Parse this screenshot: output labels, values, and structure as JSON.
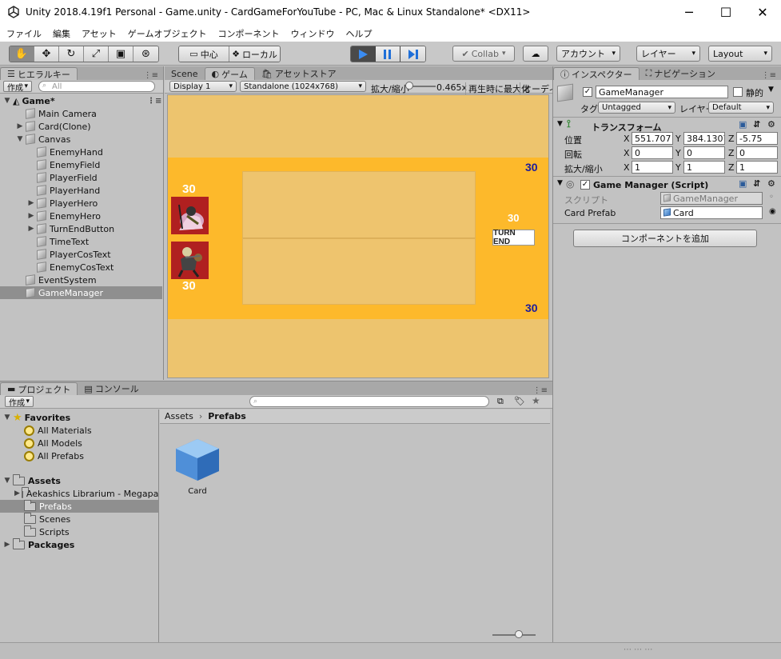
{
  "window": {
    "title": "Unity 2018.4.19f1 Personal - Game.unity - CardGameForYouTube - PC, Mac & Linux Standalone* <DX11>",
    "minimize": "─",
    "maximize": "☐",
    "close": "✕"
  },
  "menu": [
    "ファイル",
    "編集",
    "アセット",
    "ゲームオブジェクト",
    "コンポーネント",
    "ウィンドウ",
    "ヘルプ"
  ],
  "toolbar": {
    "pivot_label": "中心",
    "space_label": "ローカル",
    "collab_label": "Collab",
    "account_label": "アカウント",
    "layers_label": "レイヤー",
    "layout_label": "Layout"
  },
  "hierarchy": {
    "tab": "ヒエラルキー",
    "create": "作成",
    "search_placeholder": "All",
    "scene": "Game*",
    "items": [
      "Main Camera",
      "Card(Clone)",
      "Canvas",
      "EnemyHand",
      "EnemyField",
      "PlayerField",
      "PlayerHand",
      "PlayerHero",
      "EnemyHero",
      "TurnEndButton",
      "TimeText",
      "PlayerCosText",
      "EnemyCosText",
      "EventSystem",
      "GameManager"
    ]
  },
  "game_view": {
    "tabs": [
      "Scene",
      "ゲーム",
      "アセットストア"
    ],
    "display": "Display 1",
    "resolution": "Standalone (1024x768)",
    "scale_label": "拡大/縮小",
    "scale_value": "0.465x",
    "maximize_on_play": "再生時に最大化",
    "audio": "オーディオ",
    "enemy_hp": "30",
    "player_hp": "30",
    "time": "30",
    "turn_end": "TURN END",
    "enemy_cost": "30",
    "player_cost": "30",
    "colors": {
      "background": "#edc46e",
      "band": "#fdb92b",
      "field": "#eec46e",
      "cost": "#1c1c9c"
    }
  },
  "inspector": {
    "tabs": [
      "インスペクター",
      "ナビゲーション"
    ],
    "object_name": "GameManager",
    "static_label": "静的",
    "tag_label": "タグ",
    "tag_value": "Untagged",
    "layer_label": "レイヤー",
    "layer_value": "Default",
    "transform": {
      "title": "トランスフォーム",
      "position_label": "位置",
      "rotation_label": "回転",
      "scale_label": "拡大/縮小",
      "position": [
        "551.707",
        "384.1307",
        "-5.75"
      ],
      "rotation": [
        "0",
        "0",
        "0"
      ],
      "scale": [
        "1",
        "1",
        "1"
      ]
    },
    "script_component": {
      "title": "Game Manager (Script)",
      "script_label": "スクリプト",
      "script_value": "GameManager",
      "card_prefab_label": "Card Prefab",
      "card_prefab_value": "Card"
    },
    "add_component": "コンポーネントを追加"
  },
  "project": {
    "tabs": [
      "プロジェクト",
      "コンソール"
    ],
    "create": "作成",
    "favorites_label": "Favorites",
    "favorites": [
      "All Materials",
      "All Models",
      "All Prefabs"
    ],
    "assets_label": "Assets",
    "assets": [
      "Aekashics Librarium - Megapac",
      "Prefabs",
      "Scenes",
      "Scripts"
    ],
    "packages_label": "Packages",
    "breadcrumb": [
      "Assets",
      "Prefabs"
    ],
    "items": [
      "Card"
    ]
  }
}
